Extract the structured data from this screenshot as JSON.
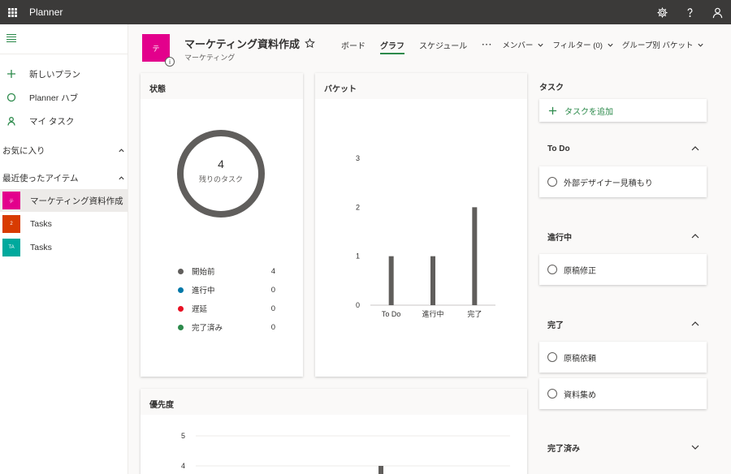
{
  "app": {
    "name": "Planner"
  },
  "sidebar": {
    "nav": [
      {
        "label": "新しいプラン",
        "icon": "plus-icon"
      },
      {
        "label": "Planner ハブ",
        "icon": "hub-icon"
      },
      {
        "label": "マイ タスク",
        "icon": "person-icon"
      }
    ],
    "favorites_label": "お気に入り",
    "recent_label": "最近使ったアイテム",
    "recent": [
      {
        "label": "マーケティング資料作成",
        "badge": "テ",
        "color": "#e3008c"
      },
      {
        "label": "Tasks",
        "badge": "2",
        "color": "#d83b01"
      },
      {
        "label": "Tasks",
        "badge": "TA",
        "color": "#00a99d"
      }
    ]
  },
  "header": {
    "avatar_letter": "テ",
    "info_glyph": "i",
    "title": "マーケティング資料作成",
    "subtitle": "マーケティング",
    "tabs": [
      {
        "label": "ボード",
        "active": false
      },
      {
        "label": "グラフ",
        "active": true
      },
      {
        "label": "スケジュール",
        "active": false
      }
    ],
    "more": "···",
    "filters": [
      {
        "label": "メンバー"
      },
      {
        "label": "フィルター (0)"
      },
      {
        "label": "グループ別 バケット"
      }
    ]
  },
  "status_card": {
    "title": "状態",
    "remaining_count": "4",
    "remaining_label": "残りのタスク",
    "legend": [
      {
        "label": "開始前",
        "value": "4",
        "color": "#605e5c"
      },
      {
        "label": "進行中",
        "value": "0",
        "color": "#0078a8"
      },
      {
        "label": "遅延",
        "value": "0",
        "color": "#e81123"
      },
      {
        "label": "完了済み",
        "value": "0",
        "color": "#2c8a4b"
      }
    ]
  },
  "bucket_card": {
    "title": "バケット"
  },
  "priority_card": {
    "title": "優先度"
  },
  "chart_data": [
    {
      "type": "pie",
      "categories": [
        "開始前",
        "進行中",
        "遅延",
        "完了済み"
      ],
      "values": [
        4,
        0,
        0,
        0
      ],
      "colors": [
        "#605e5c",
        "#0078a8",
        "#e81123",
        "#2c8a4b"
      ]
    },
    {
      "type": "bar",
      "title": "バケット",
      "categories": [
        "To Do",
        "進行中",
        "完了"
      ],
      "values": [
        1,
        1,
        2
      ],
      "ylim": [
        0,
        3
      ],
      "yticks": [
        0,
        1,
        2,
        3
      ],
      "grid": false,
      "color": "#605e5c"
    },
    {
      "type": "bar",
      "title": "優先度",
      "yticks_visible": [
        4,
        5
      ],
      "ylim": [
        0,
        5
      ],
      "values_visible": [
        4
      ],
      "grid": true,
      "color": "#605e5c"
    }
  ],
  "tasks_column": {
    "title": "タスク",
    "add_label": "タスクを追加",
    "groups": [
      {
        "name": "To Do",
        "expanded": true,
        "tasks": [
          "外部デザイナー見積もり"
        ]
      },
      {
        "name": "進行中",
        "expanded": true,
        "tasks": [
          "原稿修正"
        ]
      },
      {
        "name": "完了",
        "expanded": true,
        "tasks": [
          "原稿依頼",
          "資料集め"
        ]
      },
      {
        "name": "完了済み",
        "expanded": false,
        "tasks": []
      }
    ]
  }
}
